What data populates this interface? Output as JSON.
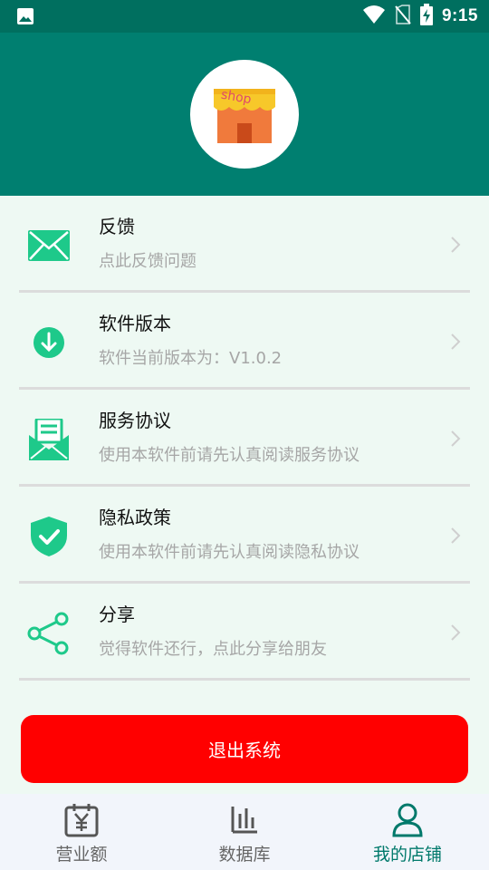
{
  "status_bar": {
    "time": "9:15"
  },
  "header": {
    "logo_text": "shop"
  },
  "menu": [
    {
      "title": "反馈",
      "subtitle": "点此反馈问题"
    },
    {
      "title": "软件版本",
      "subtitle": "软件当前版本为：V1.0.2"
    },
    {
      "title": "服务协议",
      "subtitle": "使用本软件前请先认真阅读服务协议"
    },
    {
      "title": "隐私政策",
      "subtitle": "使用本软件前请先认真阅读隐私协议"
    },
    {
      "title": "分享",
      "subtitle": "觉得软件还行，点此分享给朋友"
    }
  ],
  "logout_label": "退出系统",
  "tabs": [
    {
      "label": "营业额",
      "icon": "calendar-yen-icon"
    },
    {
      "label": "数据库",
      "icon": "bar-chart-icon"
    },
    {
      "label": "我的店铺",
      "icon": "user-icon",
      "active": true
    }
  ],
  "colors": {
    "header": "#007f70",
    "status_bar": "#006f5f",
    "accent_icon": "#1ec98a",
    "logout": "#ff0000",
    "tab_active": "#00796b"
  }
}
